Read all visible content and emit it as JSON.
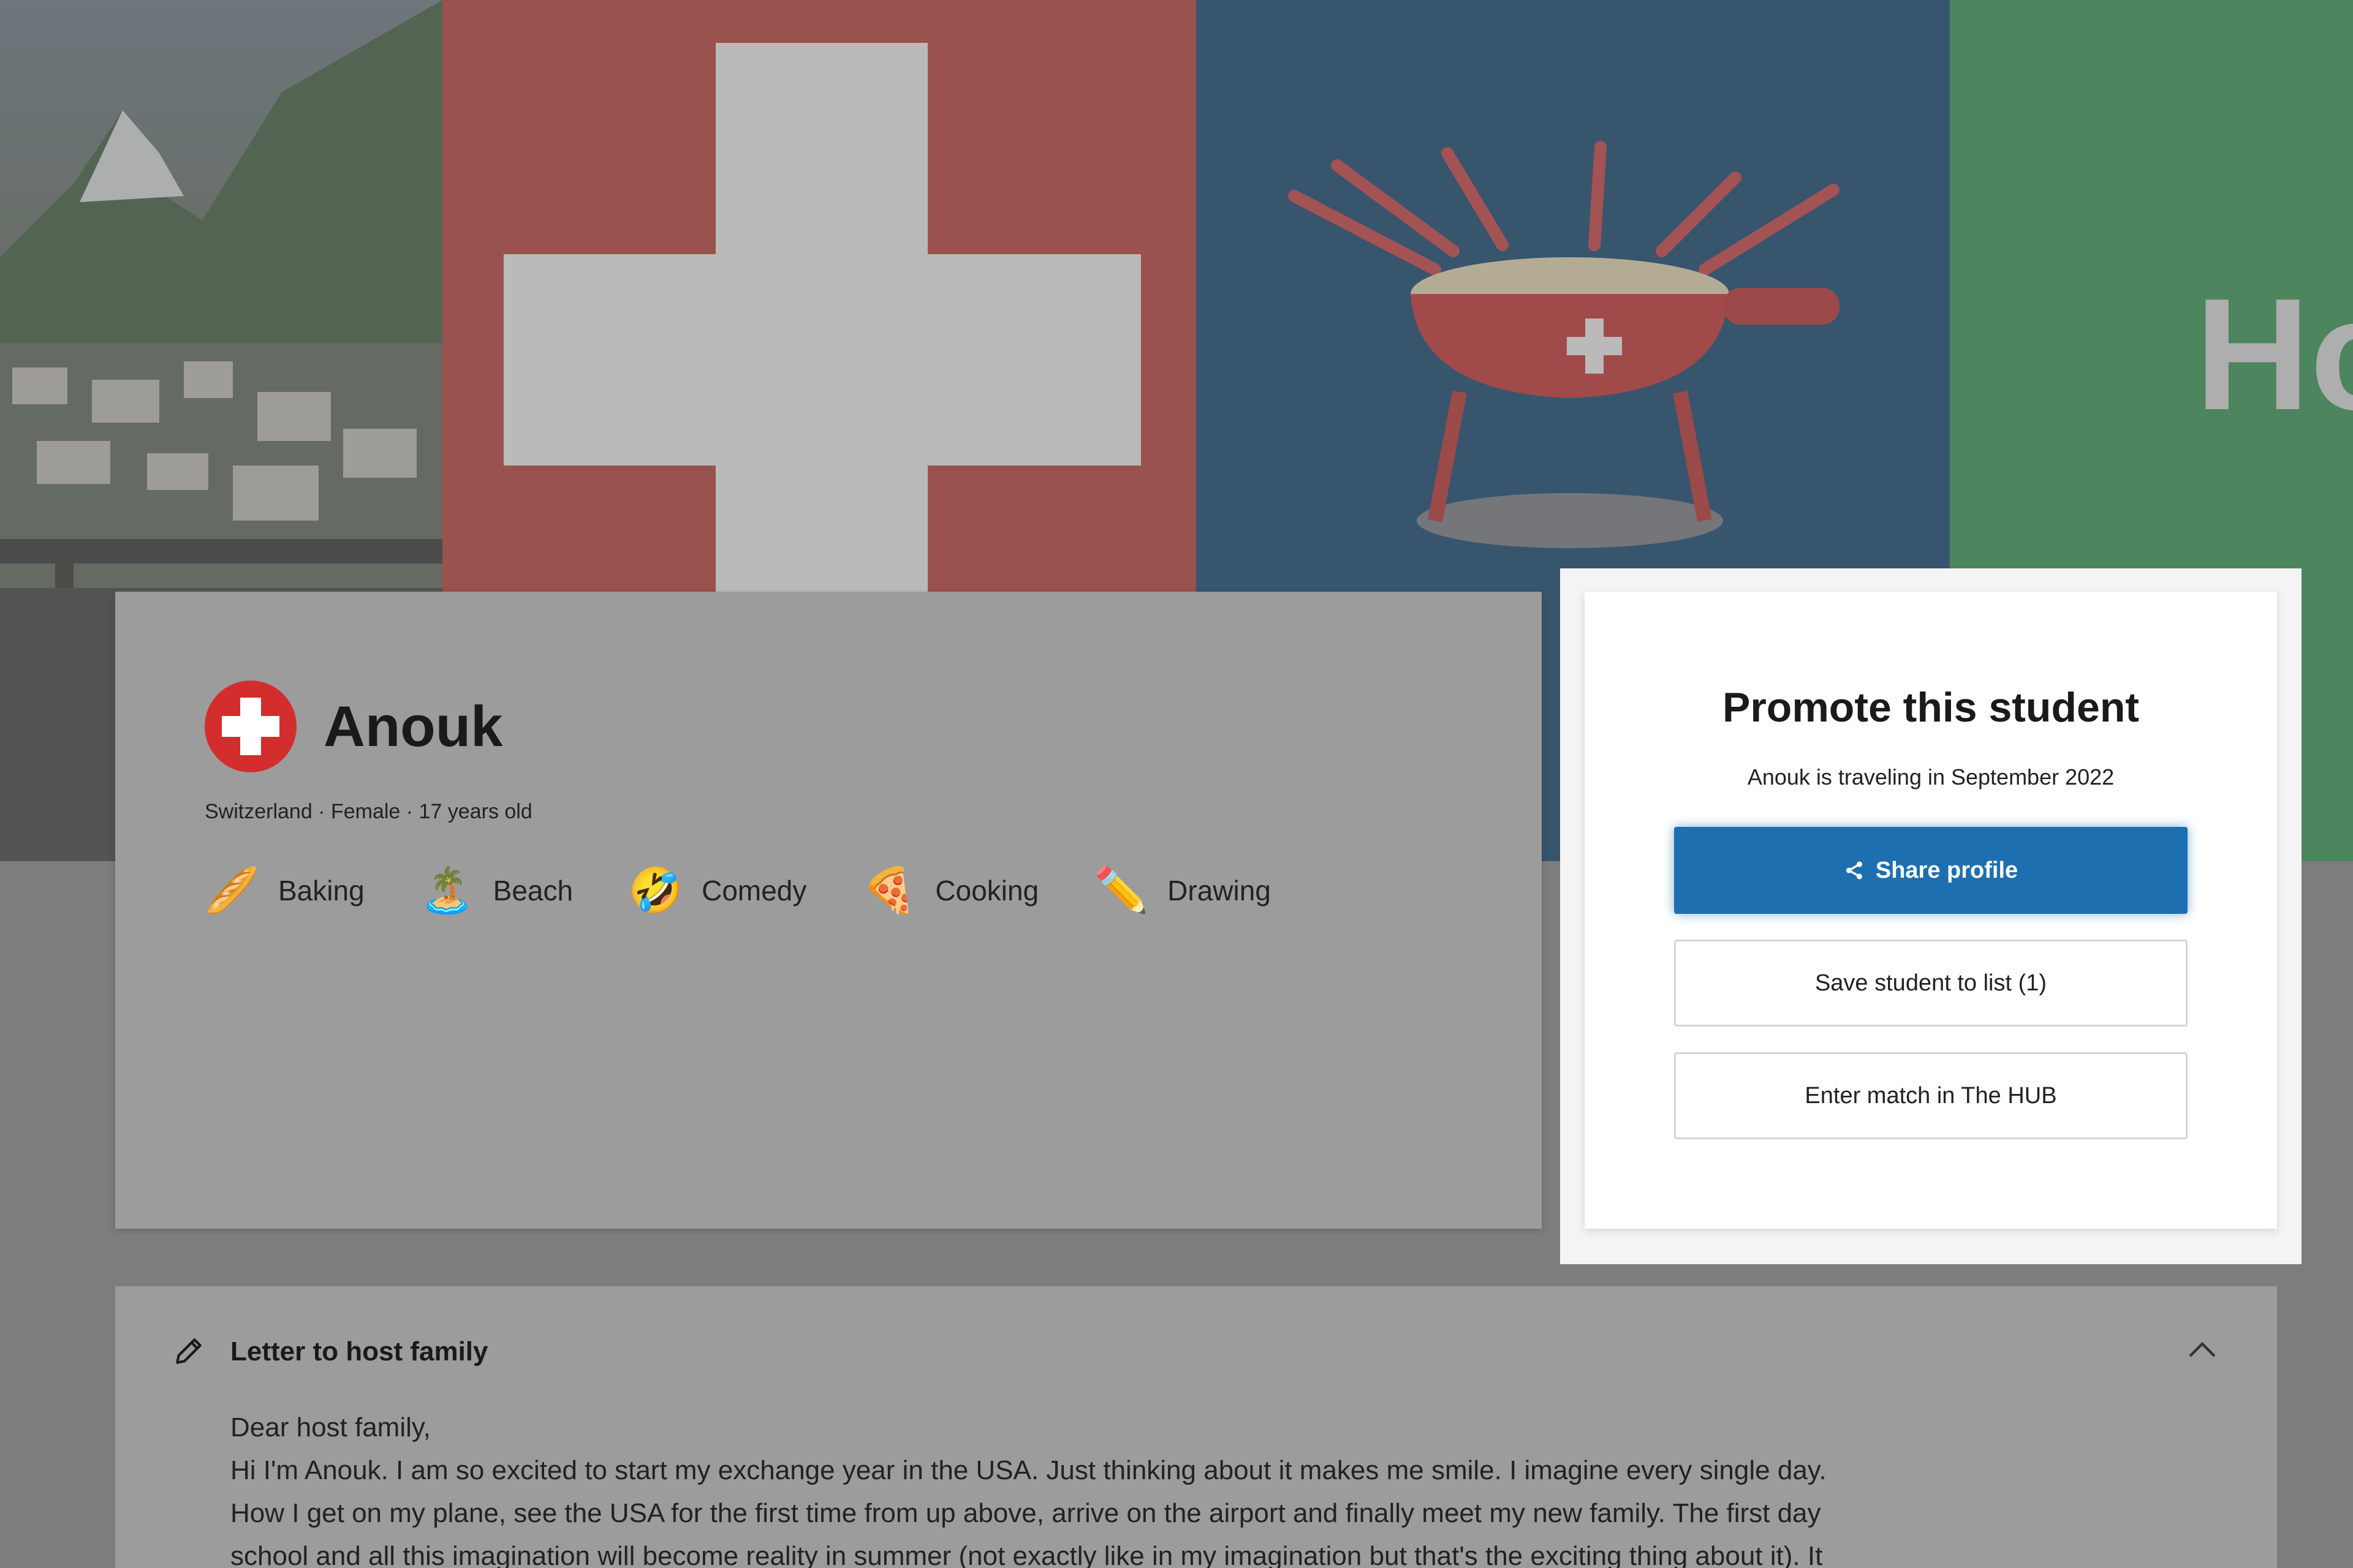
{
  "hero": {
    "green_panel_text": "Ho"
  },
  "profile": {
    "name": "Anouk",
    "meta": "Switzerland · Female · 17 years old",
    "interests": [
      {
        "emoji": "🥖",
        "label": "Baking"
      },
      {
        "emoji": "🏝️",
        "label": "Beach"
      },
      {
        "emoji": "🤣",
        "label": "Comedy"
      },
      {
        "emoji": "🍕",
        "label": "Cooking"
      },
      {
        "emoji": "✏️",
        "label": "Drawing"
      }
    ]
  },
  "promote": {
    "title": "Promote this student",
    "subtitle": "Anouk is traveling in September 2022",
    "share_label": "Share profile",
    "save_label": "Save student to list (1)",
    "hub_label": "Enter match in The HUB"
  },
  "letter": {
    "title": "Letter to host family",
    "lines": [
      "Dear host family,",
      "Hi I'm Anouk. I am so excited to start my exchange year in the USA. Just thinking about it makes me smile. I imagine every single day.",
      "How I get on my plane, see the USA for the first time from up above, arrive on the airport and finally meet my new family. The first day",
      "school and all this imagination will become reality in summer (not exactly like in my imagination but that's the exciting thing about it). It"
    ]
  },
  "colors": {
    "primary": "#1d6fb0",
    "flag_red": "#c0392f",
    "navy": "#073e6d",
    "green": "#2f9a50"
  }
}
